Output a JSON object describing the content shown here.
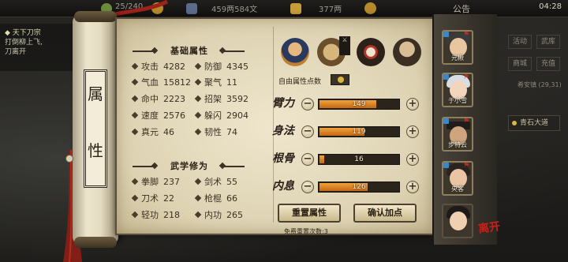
{
  "topbar": {
    "resource1": "25/240",
    "resource2": "459两584文",
    "resource3": "377两",
    "notice": "公告",
    "clock": "04:28"
  },
  "quest": {
    "title": "天下刀宗",
    "line1": "打倒柳上飞,",
    "line2": "刀离开"
  },
  "right_buttons": [
    "活动",
    "武库",
    "商城",
    "充值"
  ],
  "location": {
    "area": "希安镇",
    "coords": "(29,31)",
    "road": "青石大道"
  },
  "scroll": {
    "char1": "属",
    "char2": "性"
  },
  "basic": {
    "title": "基础属性",
    "stats": [
      {
        "label": "攻击",
        "value": "4282"
      },
      {
        "label": "防御",
        "value": "4345"
      },
      {
        "label": "气血",
        "value": "15812"
      },
      {
        "label": "聚气",
        "value": "11"
      },
      {
        "label": "命中",
        "value": "2223"
      },
      {
        "label": "招架",
        "value": "3592"
      },
      {
        "label": "速度",
        "value": "2576"
      },
      {
        "label": "躲闪",
        "value": "2904"
      },
      {
        "label": "真元",
        "value": "46"
      },
      {
        "label": "韧性",
        "value": "74"
      }
    ]
  },
  "martial": {
    "title": "武学修为",
    "stats": [
      {
        "label": "拳脚",
        "value": "237"
      },
      {
        "label": "剑术",
        "value": "55"
      },
      {
        "label": "刀术",
        "value": "22"
      },
      {
        "label": "枪棍",
        "value": "66"
      },
      {
        "label": "轻功",
        "value": "218"
      },
      {
        "label": "内功",
        "value": "265"
      }
    ]
  },
  "free_points_label": "自由属性点数",
  "attributes": [
    {
      "label": "臂力",
      "value": "149",
      "fill": 0.73
    },
    {
      "label": "身法",
      "value": "119",
      "fill": 0.58
    },
    {
      "label": "根骨",
      "value": "16",
      "fill": 0.08
    },
    {
      "label": "内息",
      "value": "126",
      "fill": 0.62
    }
  ],
  "buttons": {
    "reset": "重置属性",
    "confirm": "确认加点"
  },
  "reset_count": "免费重置次数:3",
  "party": [
    {
      "name": "元楸"
    },
    {
      "name": "于小雪"
    },
    {
      "name": "步特云"
    },
    {
      "name": "央客"
    }
  ],
  "leave_label": "离开"
}
